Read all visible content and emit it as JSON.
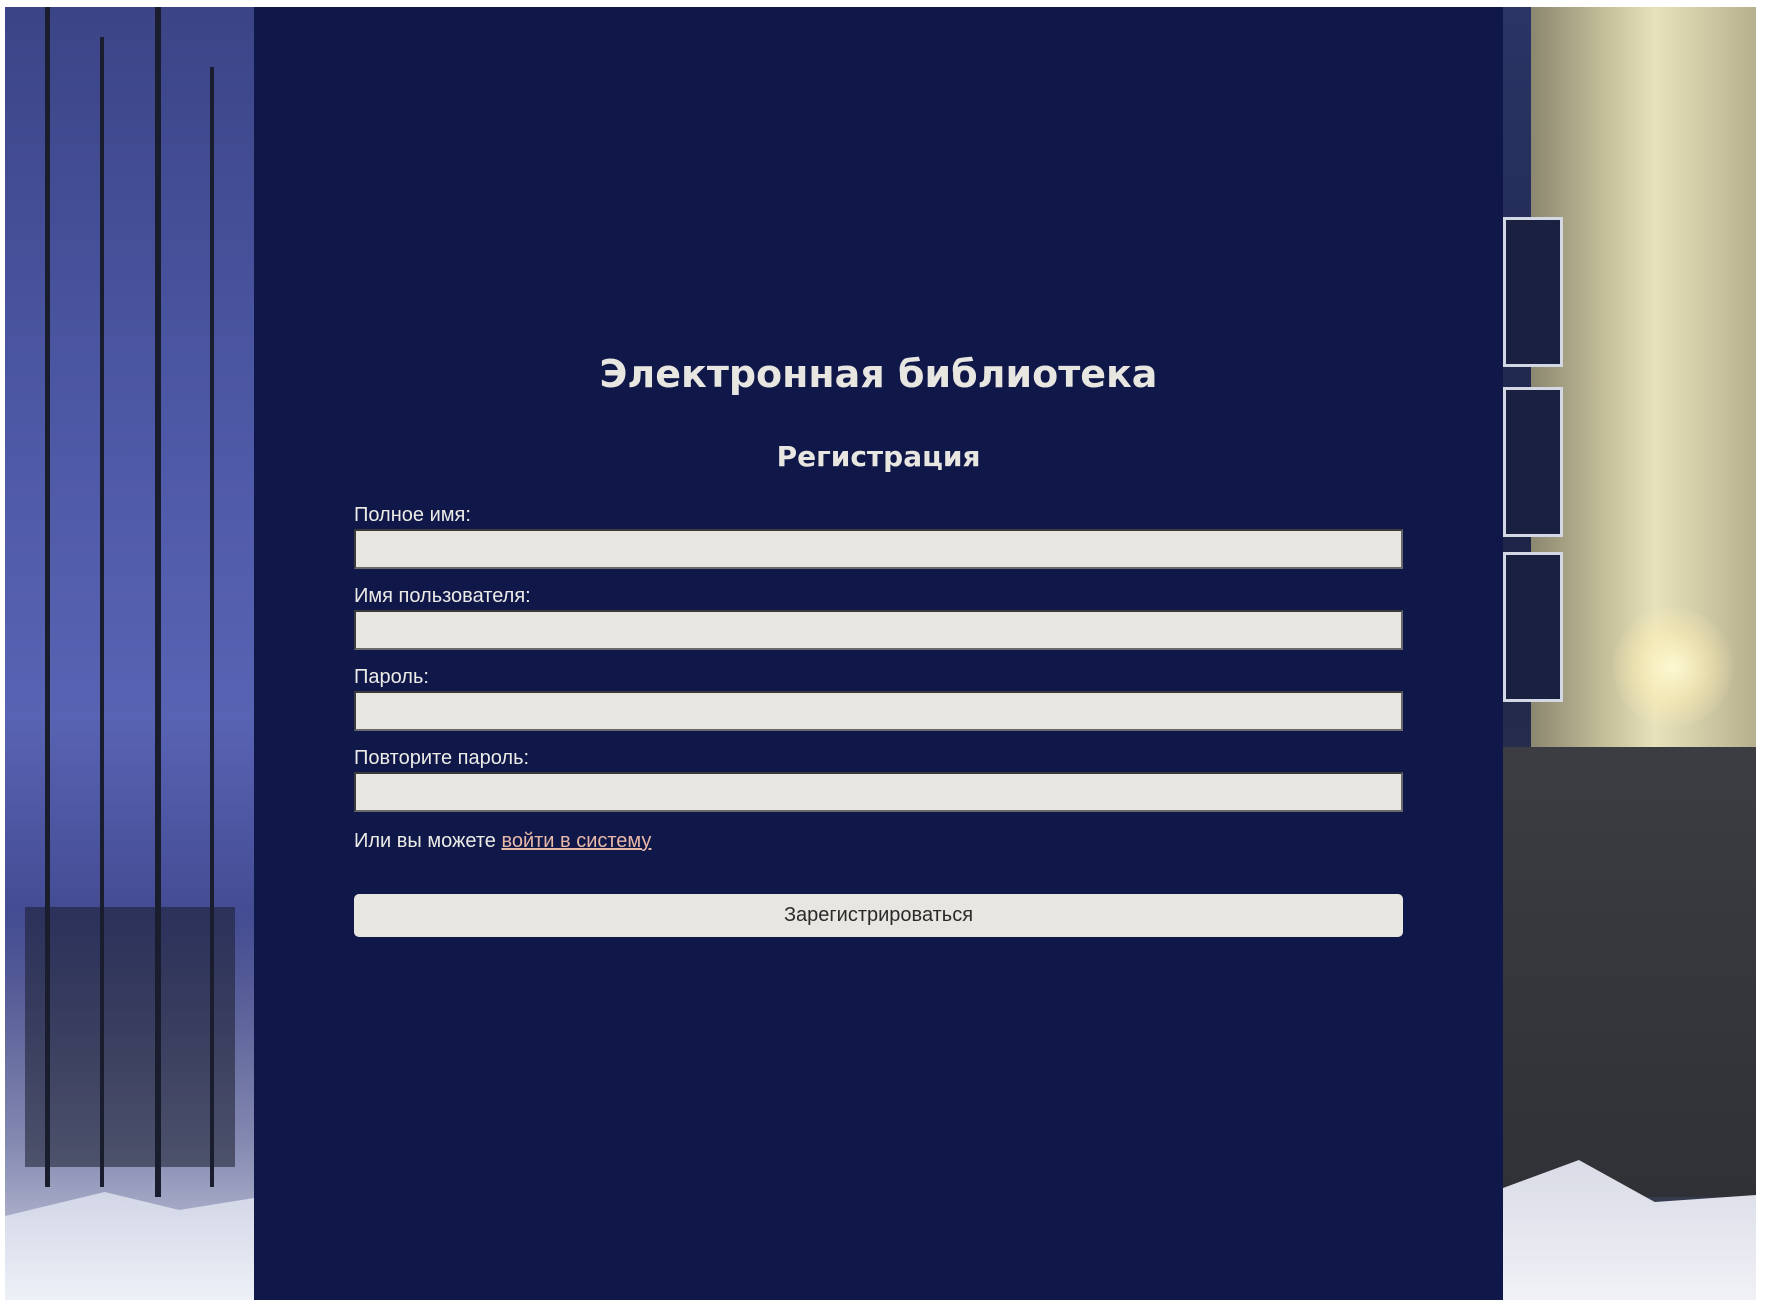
{
  "page": {
    "title": "Электронная библиотека",
    "subtitle": "Регистрация"
  },
  "form": {
    "fields": [
      {
        "label": "Полное имя:",
        "value": "",
        "type": "text"
      },
      {
        "label": "Имя пользователя:",
        "value": "",
        "type": "text"
      },
      {
        "label": "Пароль:",
        "value": "",
        "type": "password"
      },
      {
        "label": "Повторите пароль:",
        "value": "",
        "type": "password"
      }
    ],
    "login_prefix": "Или вы можете ",
    "login_link": "войти в систему",
    "submit_label": "Зарегистрироваться"
  },
  "colors": {
    "panel_bg": "#10184a",
    "text": "#ecebe6",
    "input_bg": "#e8e6e0",
    "link": "#e8b8a8"
  },
  "images": {
    "left_background": "night-trees-snow-photo",
    "right_background": "lit-building-winter-night-photo"
  }
}
